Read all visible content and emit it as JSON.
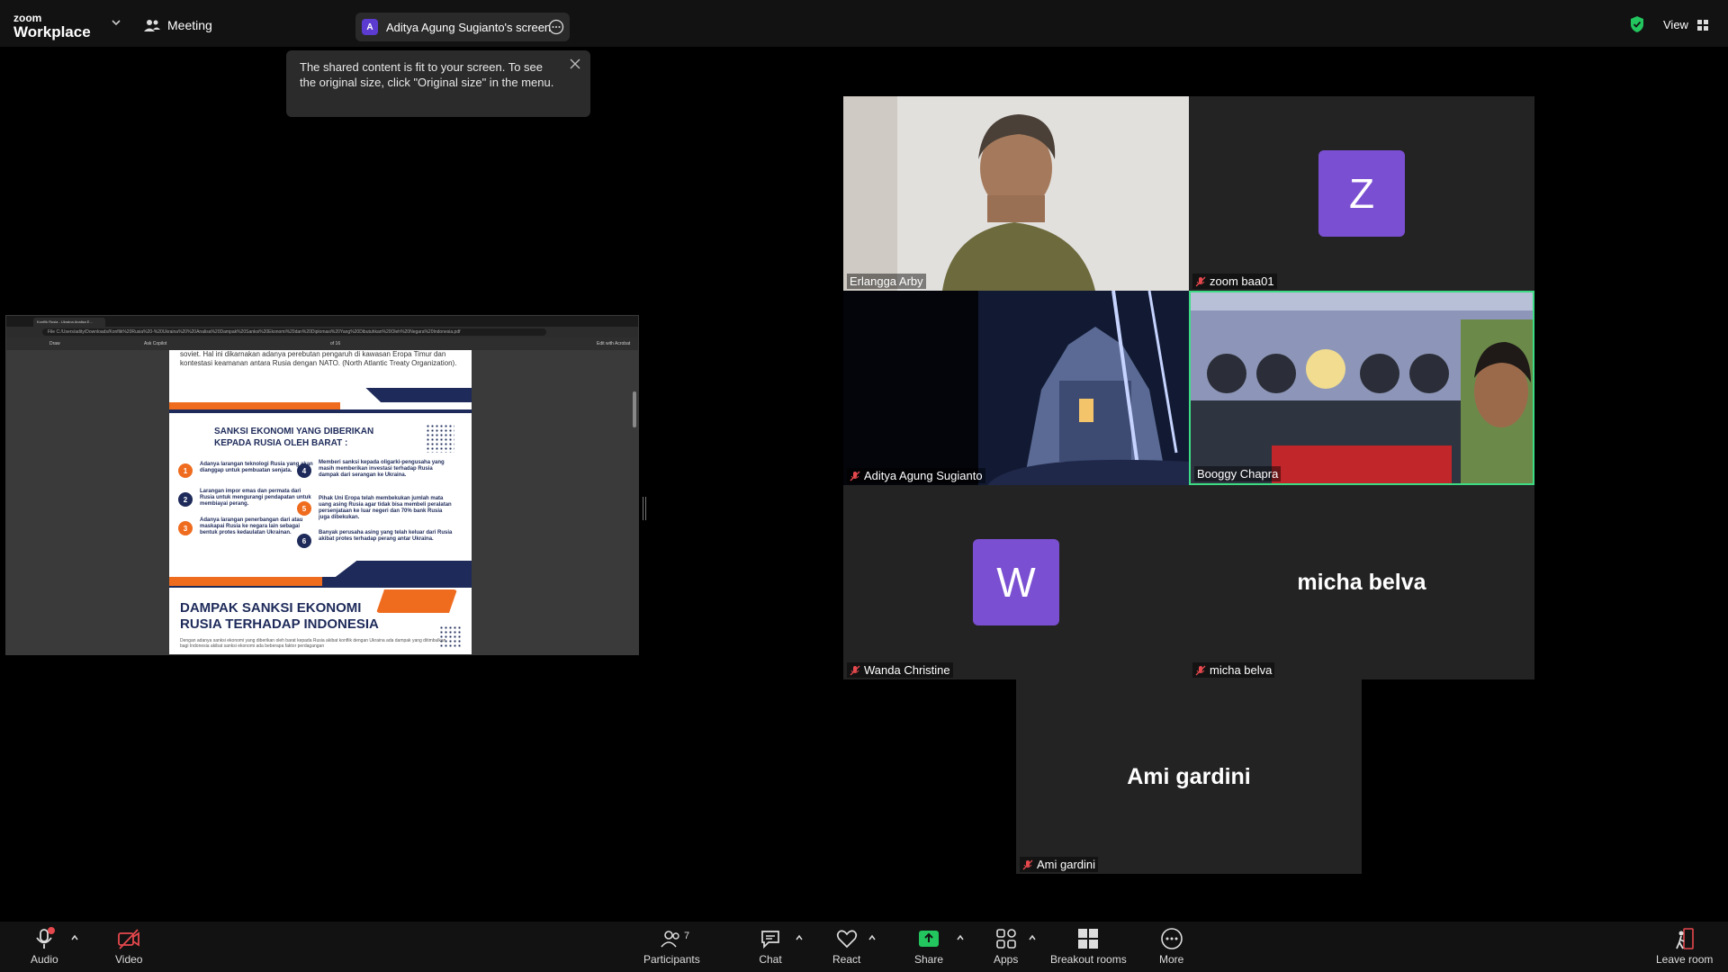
{
  "app": {
    "logo_line1": "zoom",
    "logo_line2": "Workplace"
  },
  "header": {
    "meeting_label": "Meeting",
    "share_indicator": {
      "avatar_letter": "A",
      "label": "Aditya Agung Sugianto's screen"
    },
    "view_label": "View"
  },
  "tooltip": {
    "text": "The shared content is fit to your screen. To see the original size, click \"Original size\" in the menu."
  },
  "shared_screen": {
    "browser_tab": "Konflik Rusia - Ukraina Analisa E...",
    "url": "File   C:/Users/adity/Downloads/Konflik%20Rusia%20-%20Ukraina%20%20Analisa%20Dampak%20Sanksi%20Ekonomi%20dan%20Diplomasi%20Yang%20Dibutuhkan%20Oleh%20Negara%20Indonesia.pdf",
    "toolbar": {
      "draw": "Draw",
      "ask_copilot": "Ask Copilot",
      "page": "of 16",
      "edit": "Edit with Acrobat"
    },
    "pdf": {
      "intro_text": "soviet. Hal ini dikarnakan adanya perebutan pengaruh di kawasan Eropa Timur dan kontestasi keamanan antara Rusia dengan NATO. (North Atlantic Treaty Organization).",
      "section_title_1": "SANKSI EKONOMI YANG DIBERIKAN",
      "section_title_2": "KEPADA RUSIA OLEH BARAT :",
      "items": [
        {
          "num": "1",
          "text": "Adanya larangan teknologi Rusia yang akan dianggap untuk pembuatan senjata."
        },
        {
          "num": "2",
          "text": "Larangan impor emas dan permata dari Rusia untuk mengurangi pendapatan untuk membiayai perang."
        },
        {
          "num": "3",
          "text": "Adanya larangan penerbangan dari atau maskapai Rusia ke negara lain sebagai bentuk protes kedaulatan Ukrainan."
        },
        {
          "num": "4",
          "text": "Memberi sanksi kepada oligarki-pengusaha yang masih memberikan investasi terhadap Rusia dampak dari serangan ke Ukraina."
        },
        {
          "num": "5",
          "text": "Pihak Uni Eropa telah membekukan jumlah mata uang asing Rusia agar tidak bisa membeli peralatan persenjataan ke luar negeri dan 70% bank Rusia juga dibekukan."
        },
        {
          "num": "6",
          "text": "Banyak perusaha asing yang telah keluar dari Rusia akibat protes terhadap perang antar Ukraina."
        }
      ],
      "impact_title_1": "DAMPAK SANKSI EKONOMI",
      "impact_title_2": "RUSIA TERHADAP INDONESIA",
      "impact_text": "Dengan adanya sanksi ekonomi yang diberikan oleh barat kepada Rusia akibat konflik dengan Ukraina ada dampak yang ditimbulkan bagi Indonesia akibat sanksi ekonomi ada beberapa faktor perdagangan"
    }
  },
  "participants": [
    {
      "name": "Erlangga Arby",
      "muted": false,
      "type": "video"
    },
    {
      "name": "zoom baa01",
      "muted": true,
      "type": "avatar",
      "letter": "Z"
    },
    {
      "name": "Aditya Agung Sugianto",
      "muted": true,
      "type": "video"
    },
    {
      "name": "Booggy Chapra",
      "muted": false,
      "type": "video",
      "active_speaker": true
    },
    {
      "name": "Wanda Christine",
      "muted": true,
      "type": "avatar",
      "letter": "W"
    },
    {
      "name": "micha belva",
      "muted": true,
      "type": "name"
    },
    {
      "name": "Ami gardini",
      "muted": true,
      "type": "name"
    }
  ],
  "toolbar": {
    "audio": "Audio",
    "video": "Video",
    "participants": "Participants",
    "participants_count": "7",
    "chat": "Chat",
    "react": "React",
    "share": "Share",
    "apps": "Apps",
    "breakout_rooms": "Breakout rooms",
    "more": "More",
    "leave_room": "Leave room"
  },
  "colors": {
    "avatar_purple": "#7a4fd1",
    "active_speaker_border": "#3ddc84",
    "share_green": "#22c55e",
    "mute_red": "#e5484d"
  }
}
